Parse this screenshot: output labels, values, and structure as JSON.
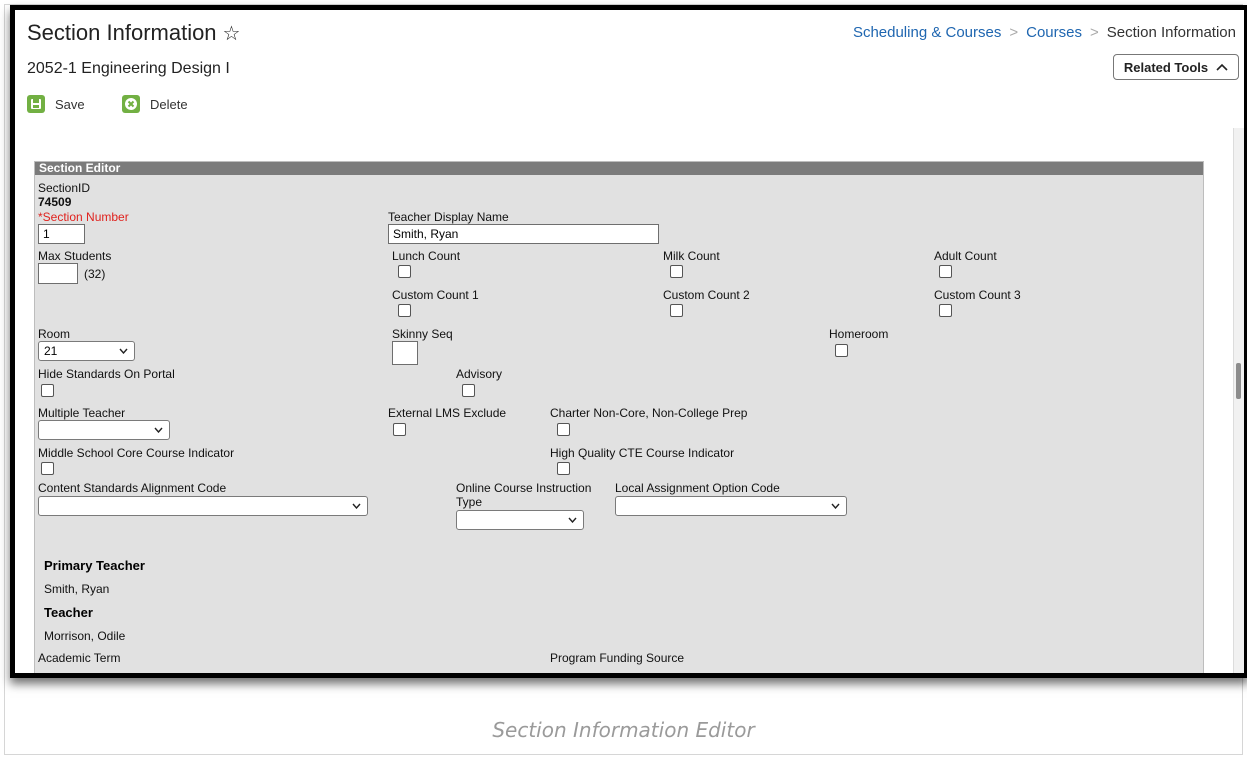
{
  "header": {
    "title": "Section Information",
    "star_icon": "☆",
    "subtitle": "2052-1 Engineering Design I",
    "breadcrumb": [
      "Scheduling & Courses",
      "Courses",
      "Section Information"
    ],
    "breadcrumb_sep": ">",
    "related_tools": "Related Tools",
    "related_icon": "^"
  },
  "toolbar": {
    "save": "Save",
    "delete": "Delete"
  },
  "editor": {
    "header": "Section Editor",
    "section_id_label": "SectionID",
    "section_id": "74509",
    "section_number_label": "*Section Number",
    "section_number": "1",
    "teacher_display_label": "Teacher Display Name",
    "teacher_display": "Smith, Ryan",
    "max_students_label": "Max Students",
    "max_students_hint": "(32)",
    "lunch_count": "Lunch Count",
    "milk_count": "Milk Count",
    "adult_count": "Adult Count",
    "custom1": "Custom Count 1",
    "custom2": "Custom Count 2",
    "custom3": "Custom Count 3",
    "room_label": "Room",
    "room_value": "21",
    "skinny_seq": "Skinny Seq",
    "homeroom": "Homeroom",
    "hide_standards": "Hide Standards On Portal",
    "advisory": "Advisory",
    "multiple_teacher": "Multiple Teacher",
    "external_lms": "External LMS Exclude",
    "charter": "Charter Non-Core, Non-College Prep",
    "middle_school": "Middle School Core Course Indicator",
    "cte": "High Quality CTE Course Indicator",
    "content_standards": "Content Standards Alignment Code",
    "online_course_1": "Online Course Instruction",
    "online_course_2": "Type",
    "local_assignment": "Local Assignment Option Code",
    "primary_teacher_label": "Primary Teacher",
    "primary_teacher": "Smith, Ryan",
    "teacher_label": "Teacher",
    "teacher": "Morrison, Odile",
    "academic_term": "Academic Term",
    "program_funding": "Program Funding Source"
  },
  "caption": "Section Information Editor"
}
